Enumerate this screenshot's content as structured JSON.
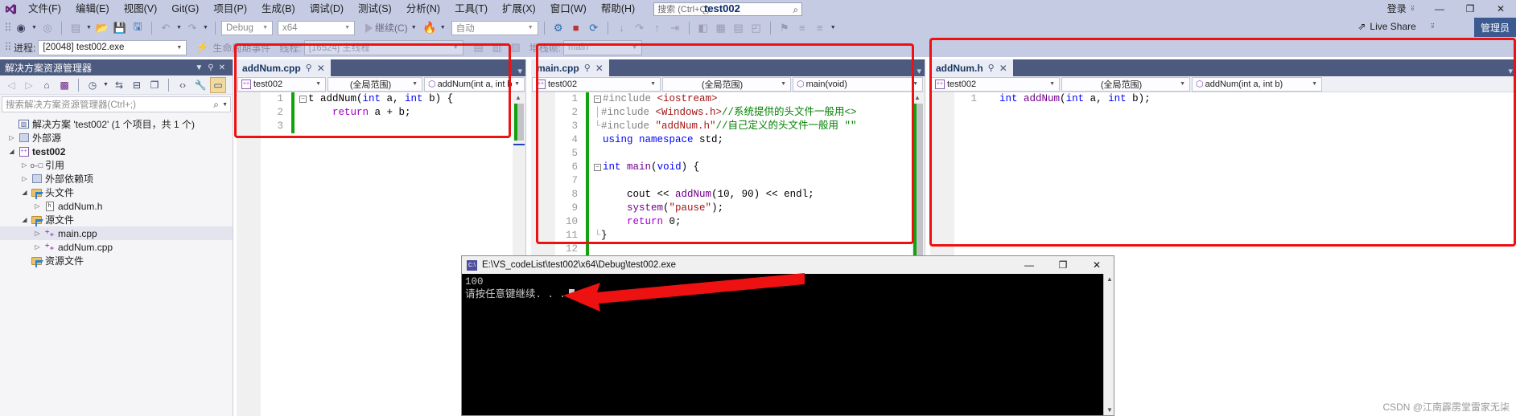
{
  "window": {
    "project_title": "test002",
    "signin_label": "登录",
    "live_share_label": "Live Share",
    "manager_badge": "管理员",
    "minimize": "—",
    "restore": "❐",
    "close": "✕"
  },
  "menu": {
    "items": [
      {
        "label": "文件(F)"
      },
      {
        "label": "编辑(E)"
      },
      {
        "label": "视图(V)"
      },
      {
        "label": "Git(G)"
      },
      {
        "label": "项目(P)"
      },
      {
        "label": "生成(B)"
      },
      {
        "label": "调试(D)"
      },
      {
        "label": "测试(S)"
      },
      {
        "label": "分析(N)"
      },
      {
        "label": "工具(T)"
      },
      {
        "label": "扩展(X)"
      },
      {
        "label": "窗口(W)"
      },
      {
        "label": "帮助(H)"
      }
    ],
    "search_placeholder": "搜索 (Ctrl+Q)"
  },
  "toolbar": {
    "config": "Debug",
    "platform": "x64",
    "run_label": "继续(C)",
    "auto_label": "自动"
  },
  "debugbar": {
    "process_label": "进程:",
    "process_value": "[20048] test002.exe",
    "lifecycle_label": "生命周期事件",
    "thread_label": "线程:",
    "thread_value": "[16524] 主线程",
    "stack_label": "堆栈帧:",
    "stack_value": "main"
  },
  "solution_explorer": {
    "title": "解决方案资源管理器",
    "search_placeholder": "搜索解决方案资源管理器(Ctrl+;)",
    "tree": [
      {
        "label": "解决方案 'test002' (1 个项目，共 1 个)",
        "indent": 0,
        "twisty": "",
        "icon": "solution-icon",
        "bold": false,
        "selected": false
      },
      {
        "label": "外部源",
        "indent": 1,
        "twisty": "▷",
        "icon": "external-sources-icon",
        "bold": false,
        "selected": false
      },
      {
        "label": "test002",
        "indent": 1,
        "twisty": "◢",
        "icon": "cpp-project-icon",
        "bold": true,
        "selected": false
      },
      {
        "label": "引用",
        "indent": 2,
        "twisty": "▷",
        "icon": "references-icon",
        "bold": false,
        "selected": false
      },
      {
        "label": "外部依赖项",
        "indent": 2,
        "twisty": "▷",
        "icon": "external-dependencies-icon",
        "bold": false,
        "selected": false
      },
      {
        "label": "头文件",
        "indent": 2,
        "twisty": "◢",
        "icon": "folder-icon",
        "bold": false,
        "selected": false
      },
      {
        "label": "addNum.h",
        "indent": 3,
        "twisty": "▷",
        "icon": "header-file-icon",
        "bold": false,
        "selected": false
      },
      {
        "label": "源文件",
        "indent": 2,
        "twisty": "◢",
        "icon": "folder-icon",
        "bold": false,
        "selected": false
      },
      {
        "label": "main.cpp",
        "indent": 3,
        "twisty": "▷",
        "icon": "cpp-file-icon",
        "bold": false,
        "selected": true
      },
      {
        "label": "addNum.cpp",
        "indent": 3,
        "twisty": "▷",
        "icon": "cpp-file-icon",
        "bold": false,
        "selected": false
      },
      {
        "label": "资源文件",
        "indent": 2,
        "twisty": "",
        "icon": "folder-icon",
        "bold": false,
        "selected": false
      }
    ]
  },
  "panes": [
    {
      "tab_label": "addNum.cpp",
      "scope_project": "test002",
      "scope_namespace": "(全局范围)",
      "scope_member": "addNum(int a, int b)",
      "lines": [
        {
          "n": "1",
          "segments": [
            {
              "t": "t addNum(",
              "c": "pl"
            },
            {
              "t": "int",
              "c": "kw"
            },
            {
              "t": " a, ",
              "c": "pl"
            },
            {
              "t": "int",
              "c": "kw"
            },
            {
              "t": " b) {",
              "c": "pl"
            }
          ],
          "fold": true
        },
        {
          "n": "2",
          "segments": [
            {
              "t": "    ",
              "c": "pl"
            },
            {
              "t": "return",
              "c": "kw2"
            },
            {
              "t": " a + b;",
              "c": "pl"
            }
          ],
          "fold": false
        },
        {
          "n": "3",
          "segments": [],
          "fold": false
        }
      ]
    },
    {
      "tab_label": "main.cpp",
      "scope_project": "test002",
      "scope_namespace": "(全局范围)",
      "scope_member": "main(void)",
      "lines": [
        {
          "n": "1",
          "segments": [
            {
              "t": "#include ",
              "c": "pp"
            },
            {
              "t": "<iostream>",
              "c": "str"
            }
          ],
          "fold": true
        },
        {
          "n": "2",
          "segments": [
            {
              "t": "#include ",
              "c": "pp"
            },
            {
              "t": "<Windows.h>",
              "c": "str"
            },
            {
              "t": "//系统提供的头文件一般用<>",
              "c": "cmt"
            }
          ],
          "fold": false
        },
        {
          "n": "3",
          "segments": [
            {
              "t": "#include ",
              "c": "pp"
            },
            {
              "t": "\"addNum.h\"",
              "c": "str"
            },
            {
              "t": "//自己定义的头文件一般用 \"\"",
              "c": "cmt"
            }
          ],
          "fold": false
        },
        {
          "n": "4",
          "segments": [
            {
              "t": "using",
              "c": "kw"
            },
            {
              "t": " ",
              "c": "pl"
            },
            {
              "t": "namespace",
              "c": "kw"
            },
            {
              "t": " std;",
              "c": "pl"
            }
          ],
          "fold": false
        },
        {
          "n": "5",
          "segments": [],
          "fold": false
        },
        {
          "n": "6",
          "segments": [
            {
              "t": "int",
              "c": "kw"
            },
            {
              "t": " ",
              "c": "pl"
            },
            {
              "t": "main",
              "c": "fn"
            },
            {
              "t": "(",
              "c": "pl"
            },
            {
              "t": "void",
              "c": "kw"
            },
            {
              "t": ") {",
              "c": "pl"
            }
          ],
          "fold": true
        },
        {
          "n": "7",
          "segments": [],
          "fold": false
        },
        {
          "n": "8",
          "segments": [
            {
              "t": "    cout ",
              "c": "pl"
            },
            {
              "t": "<<",
              "c": "pl"
            },
            {
              "t": " ",
              "c": "pl"
            },
            {
              "t": "addNum",
              "c": "fn"
            },
            {
              "t": "(10, 90) ",
              "c": "pl"
            },
            {
              "t": "<<",
              "c": "pl"
            },
            {
              "t": " endl;",
              "c": "pl"
            }
          ],
          "fold": false
        },
        {
          "n": "9",
          "segments": [
            {
              "t": "    ",
              "c": "pl"
            },
            {
              "t": "system",
              "c": "fn"
            },
            {
              "t": "(",
              "c": "pl"
            },
            {
              "t": "\"pause\"",
              "c": "str"
            },
            {
              "t": ");",
              "c": "pl"
            }
          ],
          "fold": false
        },
        {
          "n": "10",
          "segments": [
            {
              "t": "    ",
              "c": "pl"
            },
            {
              "t": "return",
              "c": "kw2"
            },
            {
              "t": " 0;",
              "c": "pl"
            }
          ],
          "fold": false
        },
        {
          "n": "11",
          "segments": [
            {
              "t": "}",
              "c": "pl"
            }
          ],
          "fold": false
        },
        {
          "n": "12",
          "segments": [],
          "fold": false
        }
      ]
    },
    {
      "tab_label": "addNum.h",
      "scope_project": "test002",
      "scope_namespace": "(全局范围)",
      "scope_member": "addNum(int a, int b)",
      "lines": [
        {
          "n": "1",
          "segments": [
            {
              "t": "int",
              "c": "kw"
            },
            {
              "t": " ",
              "c": "pl"
            },
            {
              "t": "addNum",
              "c": "fn"
            },
            {
              "t": "(",
              "c": "pl"
            },
            {
              "t": "int",
              "c": "kw"
            },
            {
              "t": " a, ",
              "c": "pl"
            },
            {
              "t": "int",
              "c": "kw"
            },
            {
              "t": " b);",
              "c": "pl"
            }
          ],
          "fold": false
        }
      ]
    }
  ],
  "console": {
    "title": "E:\\VS_codeList\\test002\\x64\\Debug\\test002.exe",
    "minimize": "—",
    "maximize": "❐",
    "close": "✕",
    "output_line1": "100",
    "output_line2": "请按任意键继续. . ."
  },
  "watermark": "CSDN @江南霹雳堂雷家无柒",
  "colors": {
    "accent": "#4b5a7e",
    "chrome": "#c5cbe3",
    "annotation_red": "#ee1111",
    "keyword_blue": "#0000ff",
    "string_red": "#a31515",
    "comment_green": "#008000",
    "function_purple": "#6f008a"
  }
}
